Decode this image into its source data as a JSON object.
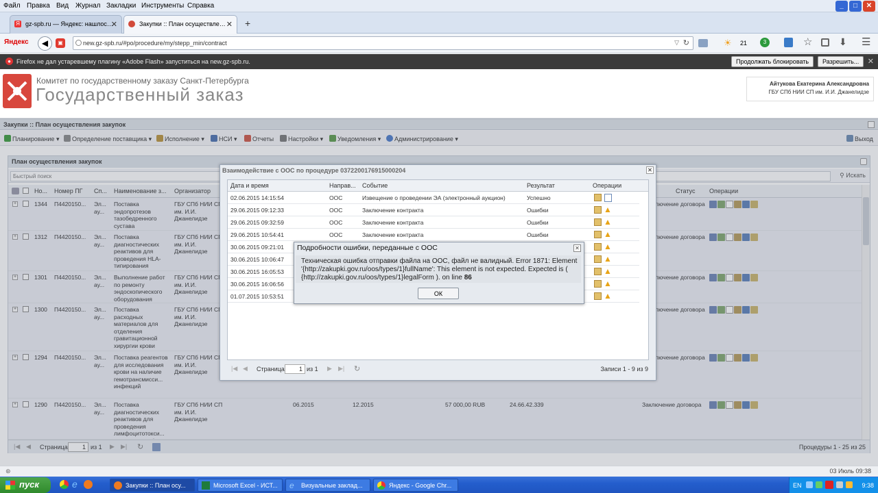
{
  "browser": {
    "menu": [
      "Файл",
      "Правка",
      "Вид",
      "Журнал",
      "Закладки",
      "Инструменты",
      "Справка"
    ],
    "tabs": [
      {
        "label": "gz-spb.ru — Яндекс: нашлос…"
      },
      {
        "label": "Закупки :: План осуществле…"
      }
    ],
    "new_tab": "+",
    "logo": "Яндекс",
    "url": "new.gz-spb.ru/#po/procedure/my/stepp_min/contract",
    "weather_temp": "21",
    "badge": "3"
  },
  "flash": {
    "message": "Firefox не дал устаревшему плагину «Adobe Flash» запуститься на new.gz-spb.ru.",
    "continue_block": "Продолжать блокировать",
    "allow": "Разрешить..."
  },
  "header": {
    "org_line": "Комитет по государственному заказу Санкт-Петербурга",
    "site_title": "Государственный заказ",
    "user_name": "Айтукова Екатерина Александровна",
    "user_org": "ГБУ СПб НИИ СП им. И.И. Джанелидзе"
  },
  "app": {
    "title": "Закупки :: План осуществления закупок",
    "toolbar": [
      "Планирование",
      "Определение поставщика",
      "Исполнение",
      "НСИ",
      "Отчеты",
      "Настройки",
      "Уведомления",
      "Администрирование"
    ],
    "logout": "Выход"
  },
  "grid": {
    "title": "План осуществления закупок",
    "search_placeholder": "Быстрый поиск",
    "search_button": "Искать",
    "columns": [
      "Но...",
      "Номер ПГ",
      "Сп...",
      "Наименование з...",
      "Организатор",
      "Статус",
      "Операции"
    ],
    "rows": [
      {
        "no": "1344",
        "pg": "П4420150...",
        "sp": "Эл... ау...",
        "name": "Поставка эндопротезов тазобедренного сустава",
        "org": "ГБУ СПб НИИ СП им. И.И. Джанелидзе",
        "status": "лючение договора"
      },
      {
        "no": "1312",
        "pg": "П4420150...",
        "sp": "Эл... ау...",
        "name": "Поставка диагностических реактивов для проведения HLA-типирования",
        "org": "ГБУ СПб НИИ СП им. И.И. Джанелидзе",
        "status": "лючение договора"
      },
      {
        "no": "1301",
        "pg": "П4420150...",
        "sp": "Эл... ау...",
        "name": "Выполнение работ по ремонту эндоскопического оборудования",
        "org": "ГБУ СПб НИИ СП им. И.И. Джанелидзе",
        "status": "лючение договора"
      },
      {
        "no": "1300",
        "pg": "П4420150...",
        "sp": "Эл... ау...",
        "name": "Поставка расходных материалов для отделения гравитационной хирургии крови",
        "org": "ГБУ СПб НИИ СП им. И.И. Джанелидзе",
        "status": "лючение договора"
      },
      {
        "no": "1294",
        "pg": "П4420150...",
        "sp": "Эл... ау...",
        "name": "Поставка реагентов для исследования крови на наличие гемотрансмисси... инфекций",
        "org": "ГБУ СПб НИИ СП им. И.И. Джанелидзе",
        "status": "лючение договора"
      },
      {
        "no": "1290",
        "pg": "П4420150...",
        "sp": "Эл... ау...",
        "name": "Поставка диагностических реактивов для проведения лимфоцитотокси... теста при подбо...",
        "org": "ГБУ СПб НИИ СП им. И.И. Джанелидзе",
        "d1": "06.2015",
        "d2": "12.2015",
        "sum": "57 000,00 RUB",
        "okpd": "24.66.42.339",
        "status": "Заключение договора"
      }
    ],
    "footer": {
      "page_label": "Страница",
      "page": "1",
      "of": "из 1",
      "records": "Процедуры 1 - 25 из 25"
    }
  },
  "oos_dialog": {
    "title": "Взаимодействие с ООС по процедуре 0372200176915000204",
    "columns": [
      "Дата и время",
      "Направ...",
      "Событие",
      "Результат",
      "Операции"
    ],
    "rows": [
      {
        "dt": "02.06.2015 14:15:54",
        "dir": "ООС",
        "event": "Извещение о проведении ЭА (электронный аукцион)",
        "result": "Успешно"
      },
      {
        "dt": "29.06.2015 09:12:33",
        "dir": "ООС",
        "event": "Заключение контракта",
        "result": "Ошибки"
      },
      {
        "dt": "29.06.2015 09:32:59",
        "dir": "ООС",
        "event": "Заключение контракта",
        "result": "Ошибки"
      },
      {
        "dt": "29.06.2015 10:54:41",
        "dir": "ООС",
        "event": "Заключение контракта",
        "result": "Ошибки"
      },
      {
        "dt": "30.06.2015 09:21:01",
        "dir": "",
        "event": "",
        "result": ""
      },
      {
        "dt": "30.06.2015 10:06:47",
        "dir": "",
        "event": "",
        "result": ""
      },
      {
        "dt": "30.06.2015 16:05:53",
        "dir": "",
        "event": "",
        "result": ""
      },
      {
        "dt": "30.06.2015 16:06:56",
        "dir": "",
        "event": "",
        "result": ""
      },
      {
        "dt": "01.07.2015 10:53:51",
        "dir": "",
        "event": "",
        "result": ""
      }
    ],
    "footer": {
      "page_label": "Страница",
      "page": "1",
      "of": "из 1",
      "records": "Записи 1 - 9 из 9"
    }
  },
  "error_dialog": {
    "title": "Подробности ошибки, переданные с ООС",
    "message": "Техническая ошибка отправки файла на ООС, файл не валидный. Error 1871: Element '{http://zakupki.gov.ru/oos/types/1}fullName': This element is not expected. Expected is ( {http://zakupki.gov.ru/oos/types/1}legalForm ). on line",
    "line": "86",
    "ok": "ОК"
  },
  "statusbar": {
    "date": "03 Июль 09:38"
  },
  "taskbar": {
    "start": "пуск",
    "tasks": [
      "Закупки :: План осу...",
      "Microsoft Excel - ИСТ...",
      "Визуальные заклад...",
      "Яндекс - Google Chr..."
    ],
    "lang": "EN",
    "time": "9:38"
  }
}
